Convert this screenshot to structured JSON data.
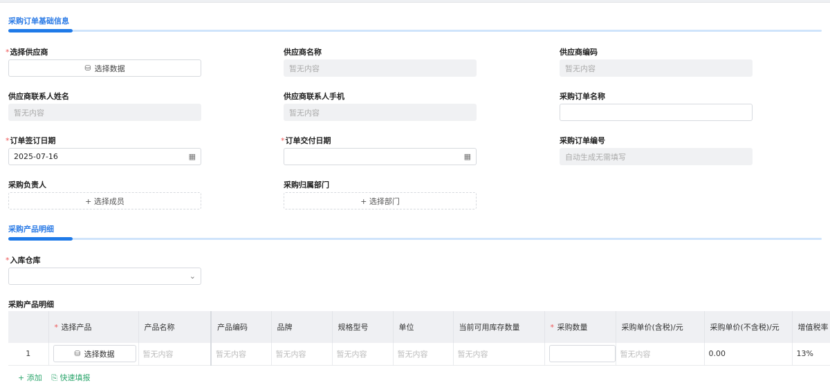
{
  "section1": "采购订单基础信息",
  "section2": "采购产品明细",
  "fields": {
    "supplier": {
      "label": "选择供应商",
      "button": "选择数据"
    },
    "supplier_name": {
      "label": "供应商名称",
      "value": "暂无内容"
    },
    "supplier_code": {
      "label": "供应商编码",
      "value": "暂无内容"
    },
    "contact_name": {
      "label": "供应商联系人姓名",
      "value": "暂无内容"
    },
    "contact_phone": {
      "label": "供应商联系人手机",
      "value": "暂无内容"
    },
    "order_name": {
      "label": "采购订单名称",
      "value": ""
    },
    "sign_date": {
      "label": "订单签订日期",
      "value": "2025-07-16"
    },
    "delivery_date": {
      "label": "订单交付日期",
      "value": ""
    },
    "order_no": {
      "label": "采购订单编号",
      "value": "自动生成无需填写"
    },
    "owner": {
      "label": "采购负责人",
      "button": "+ 选择成员"
    },
    "dept": {
      "label": "采购归属部门",
      "button": "+ 选择部门"
    },
    "warehouse": {
      "label": "入库仓库",
      "value": ""
    }
  },
  "table": {
    "label": "采购产品明细",
    "headers": [
      "",
      "选择产品",
      "产品名称",
      "产品编码",
      "品牌",
      "规格型号",
      "单位",
      "当前可用库存数量",
      "采购数量",
      "采购单价(含税)/元",
      "采购单价(不含税)/元",
      "增值税率"
    ],
    "row": {
      "index": "1",
      "select": "选择数据",
      "name": "暂无内容",
      "code": "暂无内容",
      "brand": "暂无内容",
      "spec": "暂无内容",
      "unit": "暂无内容",
      "stock": "暂无内容",
      "qty": "",
      "price_tax": "暂无内容",
      "price_notax": "0.00",
      "vat": "13%"
    }
  },
  "actions": {
    "add": "+ 添加",
    "quick": "快速填报"
  }
}
